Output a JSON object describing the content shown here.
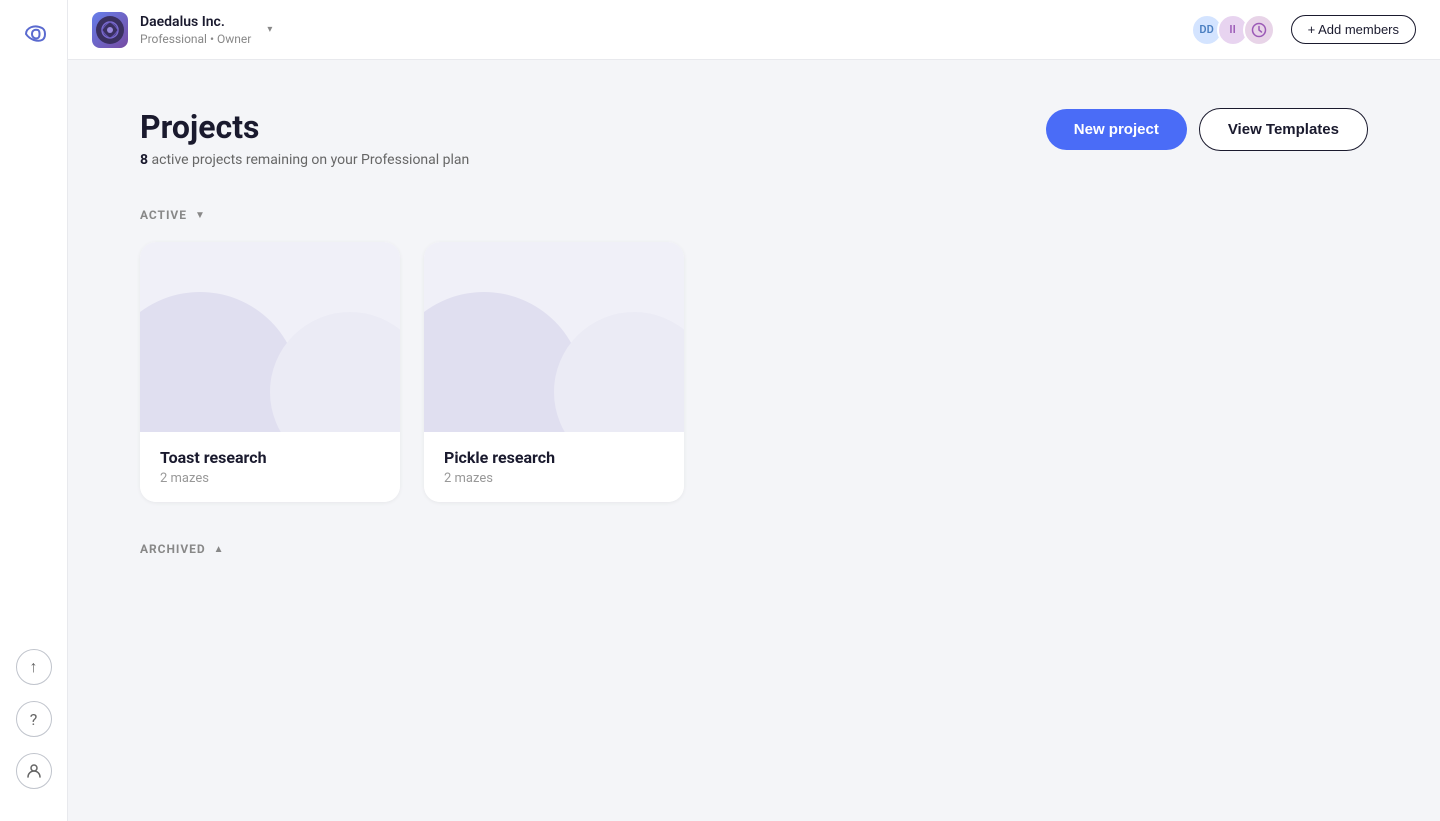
{
  "app": {
    "logo_text": "∞"
  },
  "topbar": {
    "org_name": "Daedalus Inc.",
    "org_sub": "Professional • Owner",
    "dropdown_label": "▾",
    "members": [
      {
        "initials": "DD",
        "class": "member-avatar-dd"
      },
      {
        "initials": "II",
        "class": "member-avatar-p"
      },
      {
        "initials": "🕐",
        "class": "member-avatar-clock"
      }
    ],
    "add_members_label": "+ Add members"
  },
  "sidebar": {
    "icons": [
      {
        "name": "upload-icon",
        "symbol": "↑"
      },
      {
        "name": "help-icon",
        "symbol": "?"
      },
      {
        "name": "user-icon",
        "symbol": "👤"
      }
    ]
  },
  "page": {
    "title": "Projects",
    "subtitle_count": "8",
    "subtitle_text": "active projects remaining on your Professional plan",
    "new_project_label": "New project",
    "view_templates_label": "View Templates"
  },
  "sections": {
    "active_label": "ACTIVE",
    "active_arrow": "▼",
    "archived_label": "ARCHIVED",
    "archived_arrow": "▲"
  },
  "projects": [
    {
      "name": "Toast research",
      "mazes": "2 mazes"
    },
    {
      "name": "Pickle research",
      "mazes": "2 mazes"
    }
  ]
}
